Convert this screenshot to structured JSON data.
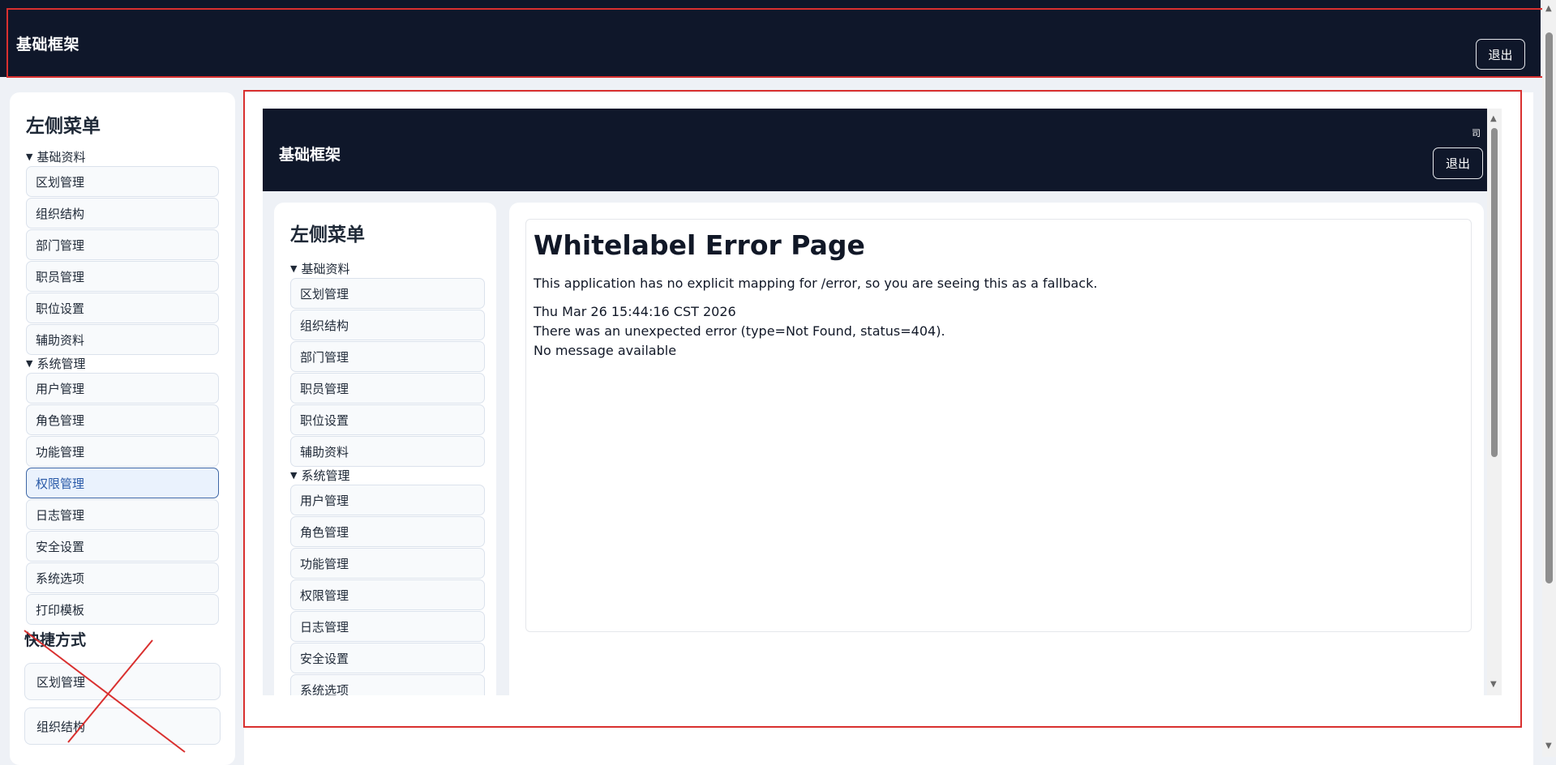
{
  "header": {
    "title": "基础框架",
    "logout_label": "退出"
  },
  "sidebar": {
    "title": "左侧菜单",
    "groups": [
      {
        "label": "基础资料",
        "items": [
          "区划管理",
          "组织结构",
          "部门管理",
          "职员管理",
          "职位设置",
          "辅助资料"
        ]
      },
      {
        "label": "系统管理",
        "items": [
          "用户管理",
          "角色管理",
          "功能管理",
          "权限管理",
          "日志管理",
          "安全设置",
          "系统选项",
          "打印模板"
        ]
      }
    ],
    "active_item": "权限管理",
    "shortcuts": {
      "title": "快捷方式",
      "items": [
        "区划管理",
        "组织结构"
      ]
    }
  },
  "frame": {
    "header": {
      "title": "基础框架",
      "tiny_text": "司",
      "logout_label": "退出"
    },
    "sidebar": {
      "title": "左侧菜单",
      "groups": [
        {
          "label": "基础资料",
          "items": [
            "区划管理",
            "组织结构",
            "部门管理",
            "职员管理",
            "职位设置",
            "辅助资料"
          ]
        },
        {
          "label": "系统管理",
          "items": [
            "用户管理",
            "角色管理",
            "功能管理",
            "权限管理",
            "日志管理",
            "安全设置",
            "系统选项"
          ]
        }
      ]
    },
    "error": {
      "heading": "Whitelabel Error Page",
      "message": "This application has no explicit mapping for /error, so you are seeing this as a fallback.",
      "timestamp": "Thu Mar 26 15:44:16 CST 2026",
      "detail": "There was an unexpected error (type=Not Found, status=404).",
      "note": "No message available"
    }
  },
  "colors": {
    "header_bg": "#0f172a",
    "outline_red": "#d9302f",
    "active_border": "#3e67a6"
  },
  "icons": {
    "collapse": "triangle-down-icon",
    "scroll_up": "chevron-up-icon",
    "scroll_down": "chevron-down-icon"
  }
}
